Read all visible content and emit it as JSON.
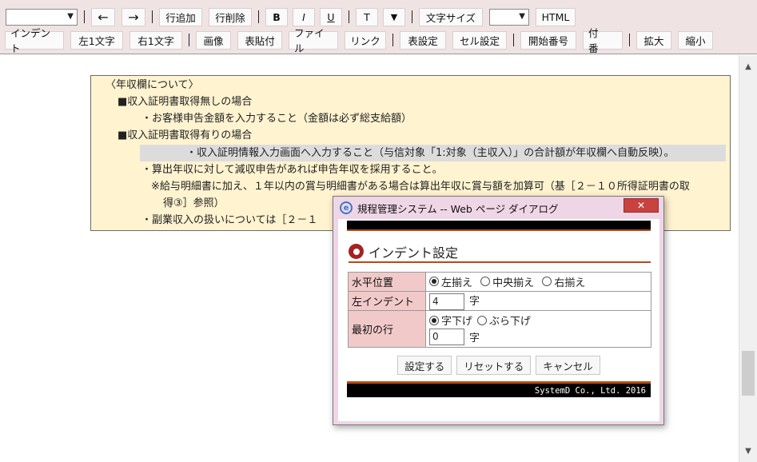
{
  "toolbar": {
    "row1": {
      "add_row": "行追加",
      "delete_row": "行削除",
      "bold": "B",
      "italic": "I",
      "underline": "U",
      "text": "T",
      "color_arrow": "▼",
      "font_size": "文字サイズ",
      "html": "HTML"
    },
    "row2": {
      "indent": "インデント",
      "left_one_char": "左1文字",
      "right_one_char": "右1文字",
      "image": "画像",
      "paste_table": "表貼付",
      "file": "ファイル",
      "link": "リンク",
      "table_settings": "表設定",
      "cell_settings": "セル設定",
      "start_number": "開始番号",
      "numbering": "付　番",
      "zoom_in": "拡大",
      "zoom_out": "縮小"
    }
  },
  "editor": {
    "lines": [
      "〈年収欄について〉",
      "■収入証明書取得無しの場合",
      "・お客様申告金額を入力すること（金額は必ず総支給額）",
      "■収入証明書取得有りの場合",
      "・収入証明情報入力画面へ入力すること（与信対象「1:対象（主収入）」の合計額が年収欄へ自動反映）。",
      "・算出年収に対して減収申告があれば申告年収を採用すること。",
      "※給与明細書に加え、１年以内の賞与明細書がある場合は算出年収に賞与額を加算可（基［２－１０所得証明書の取",
      "得③］参照）",
      "・副業収入の扱いについては［２－１"
    ]
  },
  "dialog": {
    "title": "規程管理システム -- Web ページ ダイアログ",
    "close": "✕",
    "heading": "インデント設定",
    "rows": {
      "horizontal": {
        "label": "水平位置",
        "options": [
          "左揃え",
          "中央揃え",
          "右揃え"
        ]
      },
      "left_indent": {
        "label": "左インデント",
        "value": "4",
        "unit": "字"
      },
      "first_line": {
        "label": "最初の行",
        "options": [
          "字下げ",
          "ぶら下げ"
        ],
        "value": "0",
        "unit": "字"
      }
    },
    "buttons": {
      "apply": "設定する",
      "reset": "リセットする",
      "cancel": "キャンセル"
    },
    "footer": "SystemD Co., Ltd. 2016"
  }
}
